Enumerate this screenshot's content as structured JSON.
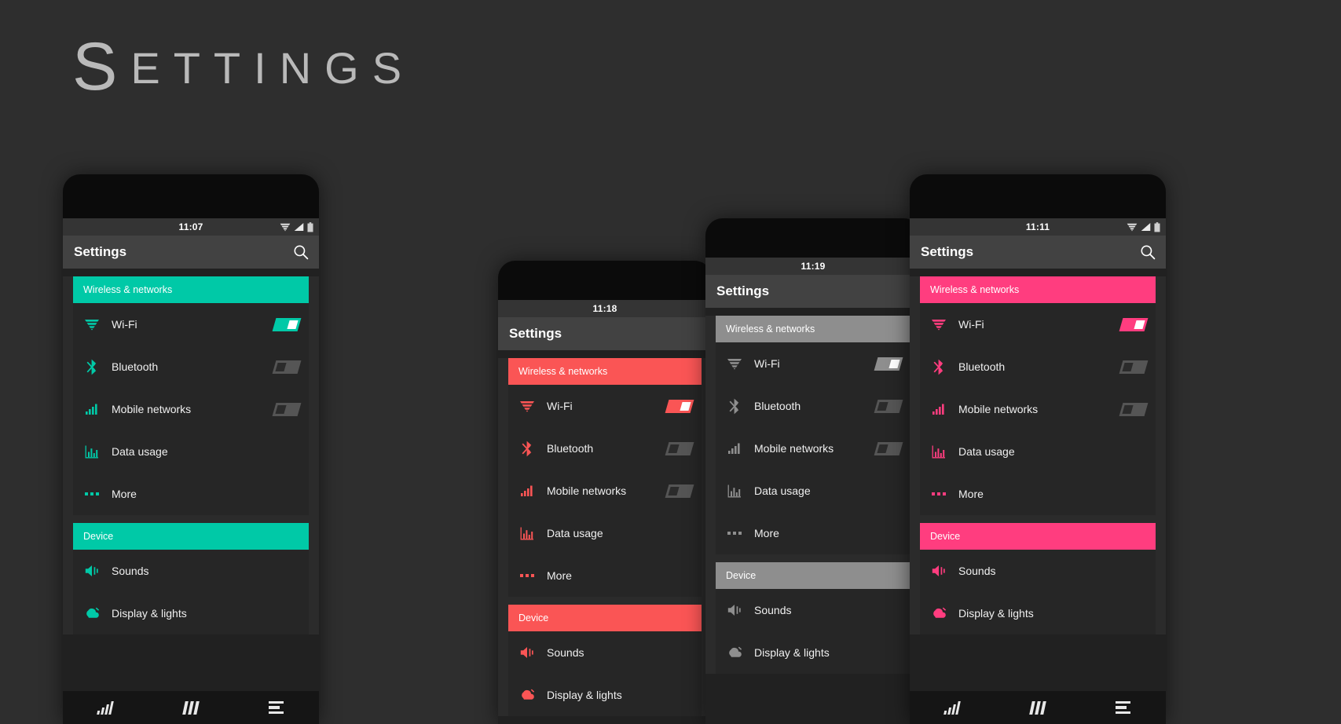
{
  "page": {
    "title_first_letter": "S",
    "title_rest": "ETTINGS",
    "background_color": "#2e2e2e"
  },
  "icon_names": {
    "wifi": "wifi-icon",
    "bluetooth": "bluetooth-icon",
    "mobile": "signal-bars-icon",
    "data": "bar-chart-icon",
    "more": "more-dots-icon",
    "sounds": "speaker-icon",
    "display": "brightness-icon",
    "search": "search-icon",
    "status_wifi": "status-wifi-icon",
    "status_signal": "status-signal-icon",
    "status_battery": "status-battery-icon",
    "nav_back": "nav-back-icon",
    "nav_home": "nav-home-icon",
    "nav_recents": "nav-recents-icon"
  },
  "common": {
    "app_title": "Settings",
    "group_wireless_label": "Wireless & networks",
    "group_device_label": "Device",
    "rows_wireless": [
      {
        "label": "Wi-Fi",
        "icon": "wifi",
        "toggle": "on"
      },
      {
        "label": "Bluetooth",
        "icon": "bluetooth",
        "toggle": "off"
      },
      {
        "label": "Mobile networks",
        "icon": "mobile",
        "toggle": "off"
      },
      {
        "label": "Data usage",
        "icon": "data",
        "toggle": "none"
      },
      {
        "label": "More",
        "icon": "more",
        "toggle": "none"
      }
    ],
    "rows_device": [
      {
        "label": "Sounds",
        "icon": "sounds",
        "toggle": "none"
      },
      {
        "label": "Display & lights",
        "icon": "display",
        "toggle": "none"
      }
    ]
  },
  "phones": [
    {
      "id": "phone-teal",
      "accent": "#00c9a7",
      "accent_text": "#ffffff",
      "clock": "11:07",
      "has_statusbar_icons": true,
      "has_navbar": true,
      "group_header_text_color": "#ffffff"
    },
    {
      "id": "phone-red",
      "accent": "#fa5555",
      "accent_text": "#ffffff",
      "clock": "11:18",
      "has_statusbar_icons": false,
      "has_navbar": false,
      "group_header_text_color": "#ffffff"
    },
    {
      "id": "phone-gray",
      "accent": "#8e8e8e",
      "accent_text": "#ffffff",
      "clock": "11:19",
      "has_statusbar_icons": false,
      "has_navbar": false,
      "group_header_text_color": "#ffffff"
    },
    {
      "id": "phone-pink",
      "accent": "#ff3d7f",
      "accent_text": "#ffffff",
      "clock": "11:11",
      "has_statusbar_icons": true,
      "has_navbar": true,
      "group_header_text_color": "#ffffff"
    }
  ]
}
